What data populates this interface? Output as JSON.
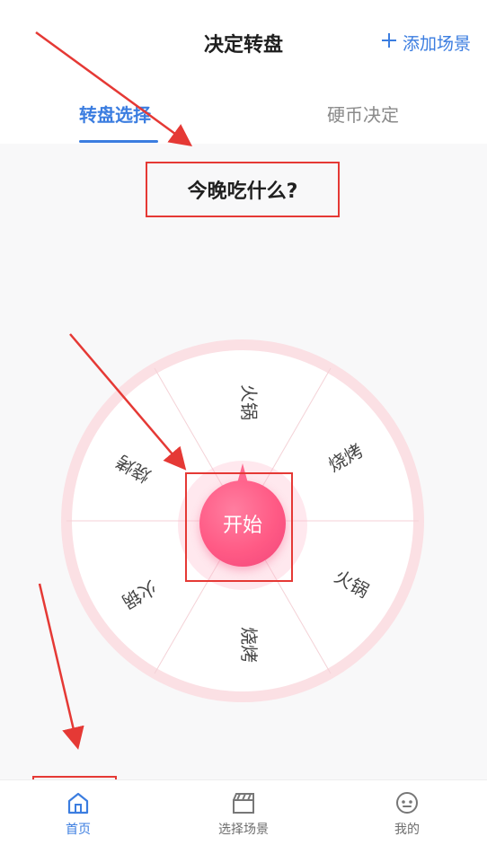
{
  "header": {
    "title": "决定转盘",
    "add_scene_label": "添加场景",
    "add_scene_icon": "plus-icon"
  },
  "tabs": [
    {
      "label": "转盘选择",
      "active": true
    },
    {
      "label": "硬币决定",
      "active": false
    }
  ],
  "question": "今晚吃什么?",
  "wheel": {
    "segments": [
      "火锅",
      "烧烤",
      "火锅",
      "烧烤",
      "火锅",
      "烧烤"
    ],
    "start_label": "开始",
    "colors": {
      "ring": "#fbe0e4",
      "divider": "#f4d2d7",
      "button": "#ff5a85"
    }
  },
  "bottom_nav": [
    {
      "label": "首页",
      "icon": "home-icon",
      "active": true
    },
    {
      "label": "选择场景",
      "icon": "clapperboard-icon",
      "active": false
    },
    {
      "label": "我的",
      "icon": "face-icon",
      "active": false
    }
  ],
  "colors": {
    "accent": "#3b7de0",
    "annotation": "#e53935"
  }
}
